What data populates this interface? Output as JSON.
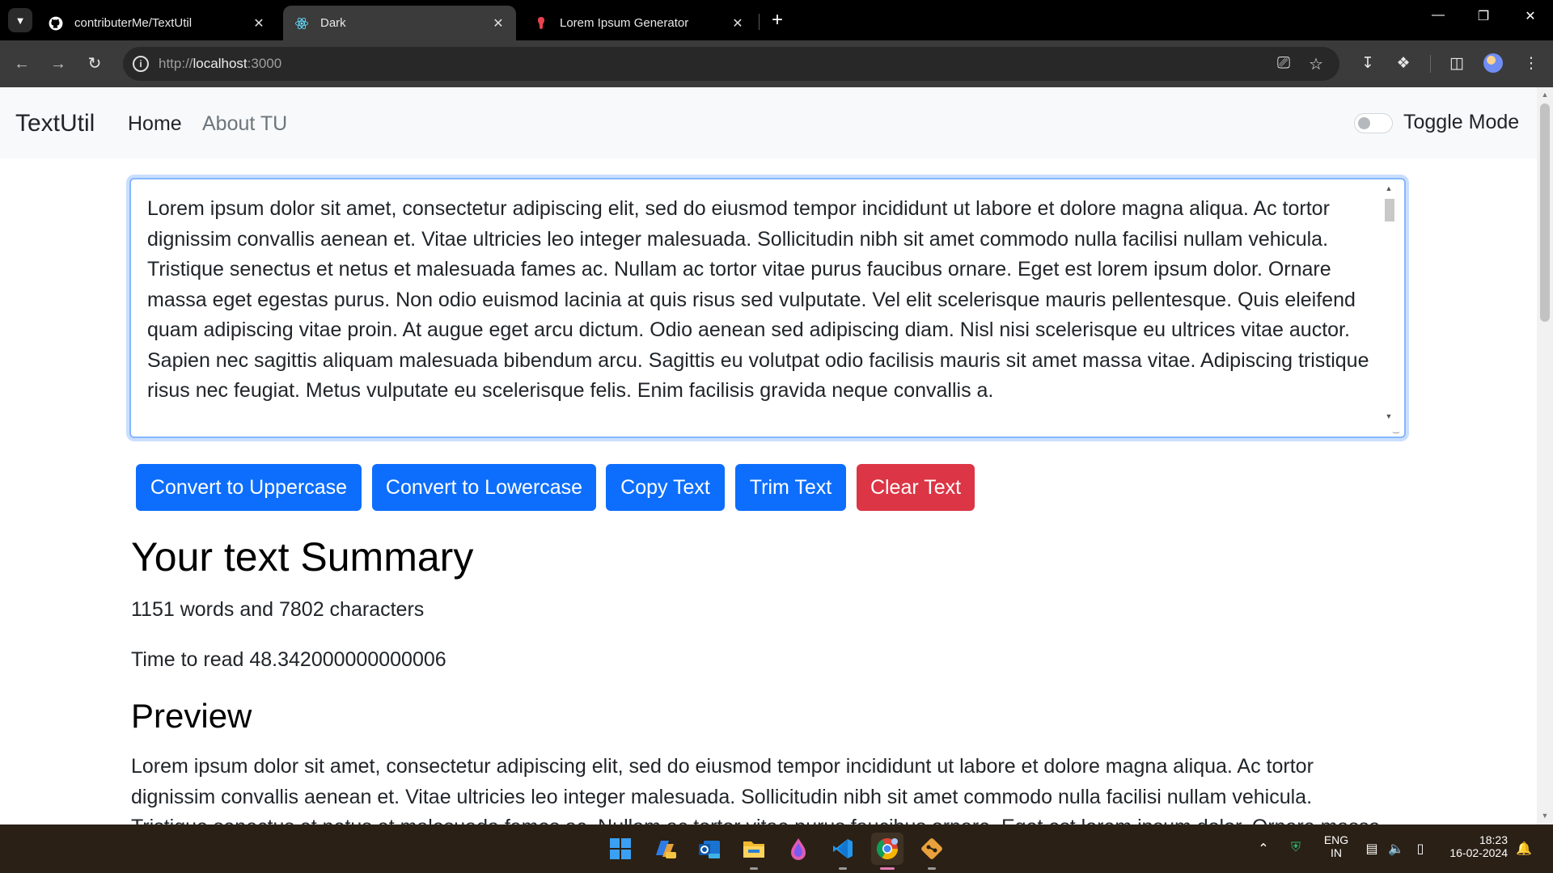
{
  "browser": {
    "tabs": [
      {
        "title": "contributerMe/TextUtil",
        "icon": "github-icon",
        "active": false
      },
      {
        "title": "Dark",
        "icon": "react-icon",
        "active": true
      },
      {
        "title": "Lorem Ipsum Generator",
        "icon": "lorem-ipsum-icon",
        "active": false
      }
    ],
    "url_scheme": "http://",
    "url_host": "localhost",
    "url_port": ":3000"
  },
  "navbar": {
    "brand": "TextUtil",
    "links": [
      "Home",
      "About TU"
    ],
    "toggle_label": "Toggle Mode",
    "toggle_on": false
  },
  "editor": {
    "text": "Lorem ipsum dolor sit amet, consectetur adipiscing elit, sed do eiusmod tempor incididunt ut labore et dolore magna aliqua. Ac tortor dignissim convallis aenean et. Vitae ultricies leo integer malesuada. Sollicitudin nibh sit amet commodo nulla facilisi nullam vehicula. Tristique senectus et netus et malesuada fames ac. Nullam ac tortor vitae purus faucibus ornare. Eget est lorem ipsum dolor. Ornare massa eget egestas purus. Non odio euismod lacinia at quis risus sed vulputate. Vel elit scelerisque mauris pellentesque. Quis eleifend quam adipiscing vitae proin. At augue eget arcu dictum. Odio aenean sed adipiscing diam. Nisl nisi scelerisque eu ultrices vitae auctor. Sapien nec sagittis aliquam malesuada bibendum arcu. Sagittis eu volutpat odio facilisis mauris sit amet massa vitae. Adipiscing tristique risus nec feugiat. Metus vulputate eu scelerisque felis. Enim facilisis gravida neque convallis a."
  },
  "buttons": {
    "uppercase": "Convert to Uppercase",
    "lowercase": "Convert to Lowercase",
    "copy": "Copy Text",
    "trim": "Trim Text",
    "clear": "Clear Text"
  },
  "summary": {
    "heading": "Your text Summary",
    "counts": "1151 words and 7802 characters",
    "read_time": "Time to read 48.342000000000006"
  },
  "preview": {
    "heading": "Preview",
    "text": "Lorem ipsum dolor sit amet, consectetur adipiscing elit, sed do eiusmod tempor incididunt ut labore et dolore magna aliqua. Ac tortor dignissim convallis aenean et. Vitae ultricies leo integer malesuada. Sollicitudin nibh sit amet commodo nulla facilisi nullam vehicula. Tristique senectus et netus et malesuada fames ac. Nullam ac tortor vitae purus faucibus ornare. Eget est lorem ipsum dolor. Ornare massa eget egestas"
  },
  "taskbar": {
    "apps": [
      "windows-start-icon",
      "copilot-icon",
      "outlook-icon",
      "file-explorer-icon",
      "paint-icon",
      "vscode-icon",
      "chrome-icon",
      "git-icon"
    ],
    "language": "ENG",
    "region": "IN",
    "time": "18:23",
    "date": "16-02-2024"
  },
  "colors": {
    "primary": "#0d6efd",
    "danger": "#dc3545",
    "navbar_bg": "#f8f9fa",
    "focus_border": "#86b7fe"
  }
}
